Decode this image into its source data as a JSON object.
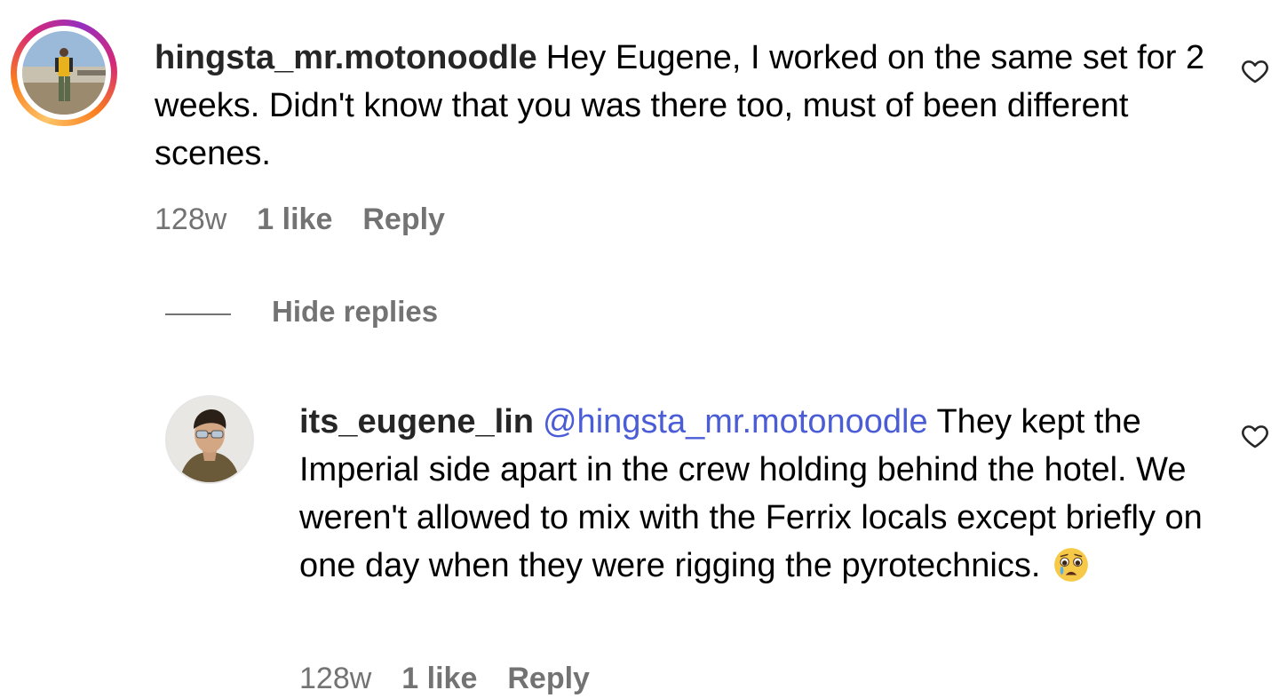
{
  "comment": {
    "username": "hingsta_mr.motonoodle",
    "text": "Hey Eugene, I worked on the same set for 2 weeks. Didn't know that you was there too, must of been different scenes.",
    "age": "128w",
    "likes": "1 like",
    "reply_label": "Reply",
    "avatar_icon": "profile-photo",
    "heart_icon": "heart-outline-icon"
  },
  "hide_replies": {
    "label": "Hide replies"
  },
  "reply": {
    "username": "its_eugene_lin",
    "mention": "@hingsta_mr.motonoodle",
    "text": "They kept the Imperial side apart in the crew holding behind the hotel. We weren't allowed to mix with the Ferrix locals except briefly on one day when they were rigging the pyrotechnics.",
    "emoji": "crying-face-emoji",
    "age": "128w",
    "likes": "1 like",
    "reply_label": "Reply",
    "avatar_icon": "profile-photo",
    "heart_icon": "heart-outline-icon"
  },
  "colors": {
    "username": "#262626",
    "mention": "#4a5cd6",
    "meta": "#737373"
  }
}
